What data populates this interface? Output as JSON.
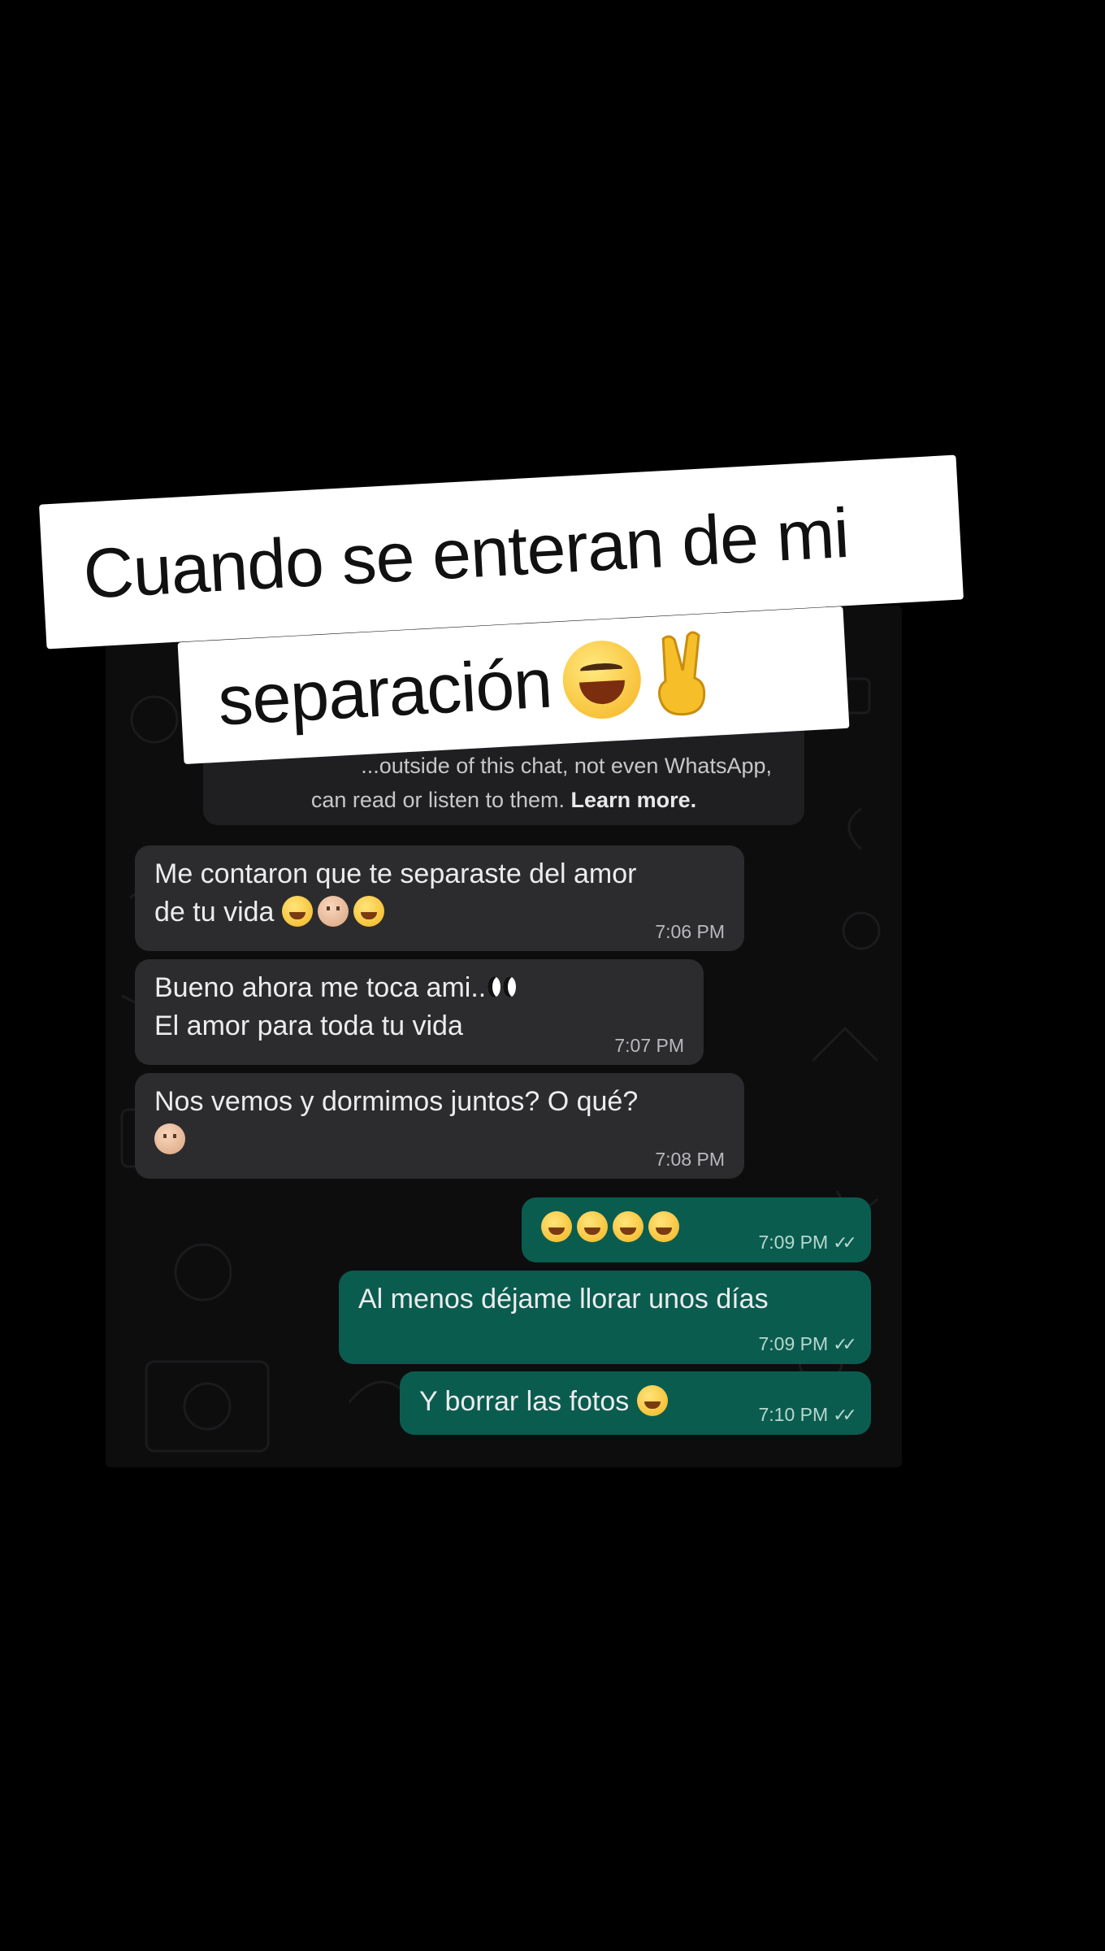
{
  "caption": {
    "line1": "Cuando se enteran de mi",
    "line2": "separación",
    "emojis": [
      "grinning-squinting-face",
      "victory-hand"
    ]
  },
  "encryption_notice": {
    "line1": "...outside of this chat, not even WhatsApp,",
    "line2_prefix": "can read or listen to them. ",
    "learn_more": "Learn more."
  },
  "messages": [
    {
      "direction": "incoming",
      "lines": [
        "Me contaron que te separaste del amor",
        "de tu vida"
      ],
      "emojis": [
        "face-with-hand-over-mouth",
        "see-no-evil-monkey",
        "grinning-face-with-sweat"
      ],
      "time": "7:06 PM"
    },
    {
      "direction": "incoming",
      "lines": [
        "Bueno ahora me toca ami..",
        "El amor para toda tu vida"
      ],
      "emojis": [
        "eyes"
      ],
      "time": "7:07 PM"
    },
    {
      "direction": "incoming",
      "lines": [
        "Nos vemos y dormimos juntos? O qué?"
      ],
      "emojis": [
        "see-no-evil-monkey"
      ],
      "time": "7:08 PM"
    },
    {
      "direction": "outgoing",
      "lines": [
        ""
      ],
      "emojis": [
        "face-with-tears-of-joy",
        "face-with-tears-of-joy",
        "face-with-tears-of-joy",
        "rolling-on-floor-laughing"
      ],
      "time": "7:09 PM",
      "status": "read"
    },
    {
      "direction": "outgoing",
      "lines": [
        "Al menos déjame llorar unos días"
      ],
      "emojis": [],
      "time": "7:09 PM",
      "status": "read"
    },
    {
      "direction": "outgoing",
      "lines": [
        "Y borrar las fotos"
      ],
      "emojis": [
        "face-with-tears-of-joy"
      ],
      "time": "7:10 PM",
      "status": "read"
    }
  ],
  "colors": {
    "background": "#000000",
    "incoming_bubble": "#2c2c2e",
    "outgoing_bubble": "#0a5c4f",
    "caption_box": "#ffffff"
  }
}
